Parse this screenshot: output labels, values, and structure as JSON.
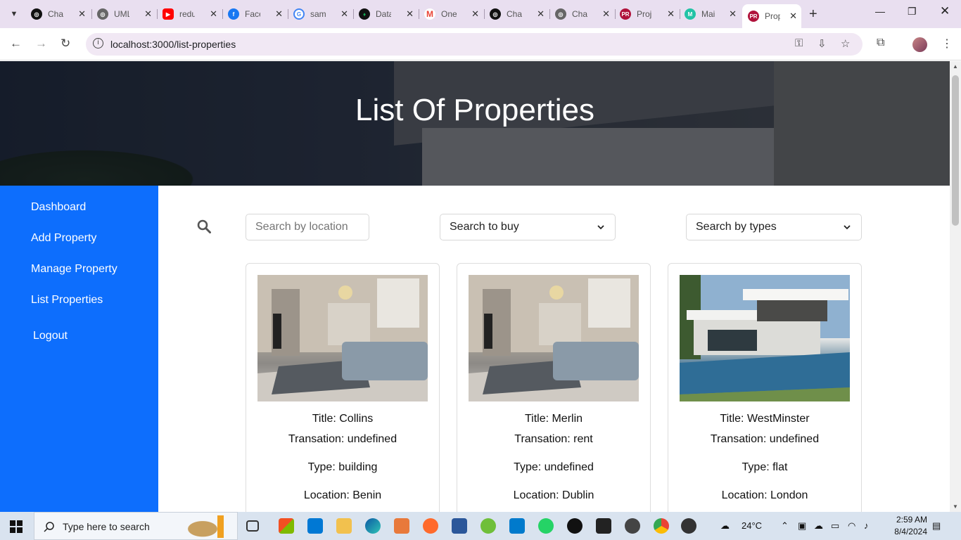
{
  "browser": {
    "tabs": [
      {
        "title": "Cha",
        "icon": "chatgpt-icon",
        "color": "#111"
      },
      {
        "title": "UML",
        "icon": "openai-icon",
        "color": "#555"
      },
      {
        "title": "redu",
        "icon": "youtube-icon",
        "color": "#ff0000"
      },
      {
        "title": "Face",
        "icon": "facebook-icon",
        "color": "#1877f2"
      },
      {
        "title": "sam",
        "icon": "google-icon",
        "color": "#4285f4"
      },
      {
        "title": "Data",
        "icon": "mongodb-icon",
        "color": "#13aa52"
      },
      {
        "title": "One",
        "icon": "gmail-icon",
        "color": "#ea4335"
      },
      {
        "title": "Cha",
        "icon": "chatgpt-icon",
        "color": "#111"
      },
      {
        "title": "Cha",
        "icon": "openai-icon",
        "color": "#555"
      },
      {
        "title": "Proj",
        "icon": "pr-icon",
        "color": "#b0123b"
      },
      {
        "title": "Mai",
        "icon": "mailtrap-icon",
        "color": "#22c3a6"
      },
      {
        "title": "Prop",
        "icon": "pr-icon",
        "color": "#b0123b"
      }
    ],
    "url": "localhost:3000/list-properties"
  },
  "page": {
    "title": "List Of Properties"
  },
  "sidebar": {
    "items": [
      {
        "label": "Dashboard"
      },
      {
        "label": "Add Property"
      },
      {
        "label": "Manage Property"
      },
      {
        "label": "List Properties"
      },
      {
        "label": "Logout"
      }
    ]
  },
  "filters": {
    "location_placeholder": "Search by location",
    "buy_value": "Search to buy",
    "types_value": "Search by types"
  },
  "cards": [
    {
      "title": "Title: Collins",
      "transaction": "Transation: undefined",
      "type": "Type: building",
      "location": "Location: Benin",
      "image": "living-room"
    },
    {
      "title": "Title: Merlin",
      "transaction": "Transation: rent",
      "type": "Type: undefined",
      "location": "Location: Dublin",
      "image": "living-room"
    },
    {
      "title": "Title: WestMinster",
      "transaction": "Transation: undefined",
      "type": "Type: flat",
      "location": "Location: London",
      "image": "villa-pool"
    }
  ],
  "taskbar": {
    "search_placeholder": "Type here to search",
    "weather": "24°C",
    "time": "2:59 AM",
    "date": "8/4/2024"
  },
  "colors": {
    "sidebar": "#0d6efd",
    "tabbar": "#e9dff0",
    "omnibox": "#f1e8f4"
  }
}
